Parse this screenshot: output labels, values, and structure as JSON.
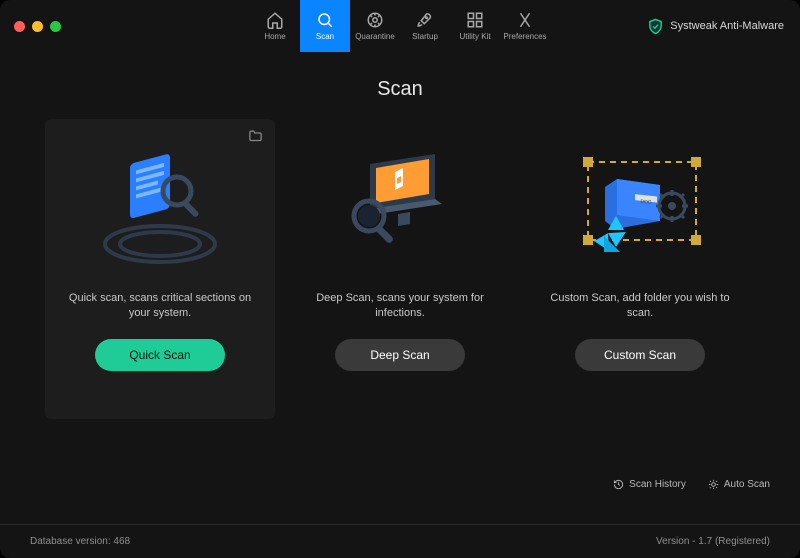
{
  "nav": {
    "items": [
      {
        "label": "Home"
      },
      {
        "label": "Scan"
      },
      {
        "label": "Quarantine"
      },
      {
        "label": "Startup"
      },
      {
        "label": "Utility Kit"
      },
      {
        "label": "Preferences"
      }
    ]
  },
  "brand": {
    "name": "Systweak Anti-Malware"
  },
  "page": {
    "title": "Scan"
  },
  "cards": {
    "quick": {
      "desc": "Quick scan, scans critical sections on your system.",
      "btn": "Quick Scan"
    },
    "deep": {
      "desc": "Deep Scan, scans your system for infections.",
      "btn": "Deep Scan"
    },
    "custom": {
      "desc": "Custom Scan, add folder you wish to scan.",
      "btn": "Custom Scan"
    }
  },
  "actions": {
    "history": "Scan History",
    "auto": "Auto Scan"
  },
  "footer": {
    "db": "Database version: 468",
    "ver": "Version  -  1.7 (Registered)"
  }
}
